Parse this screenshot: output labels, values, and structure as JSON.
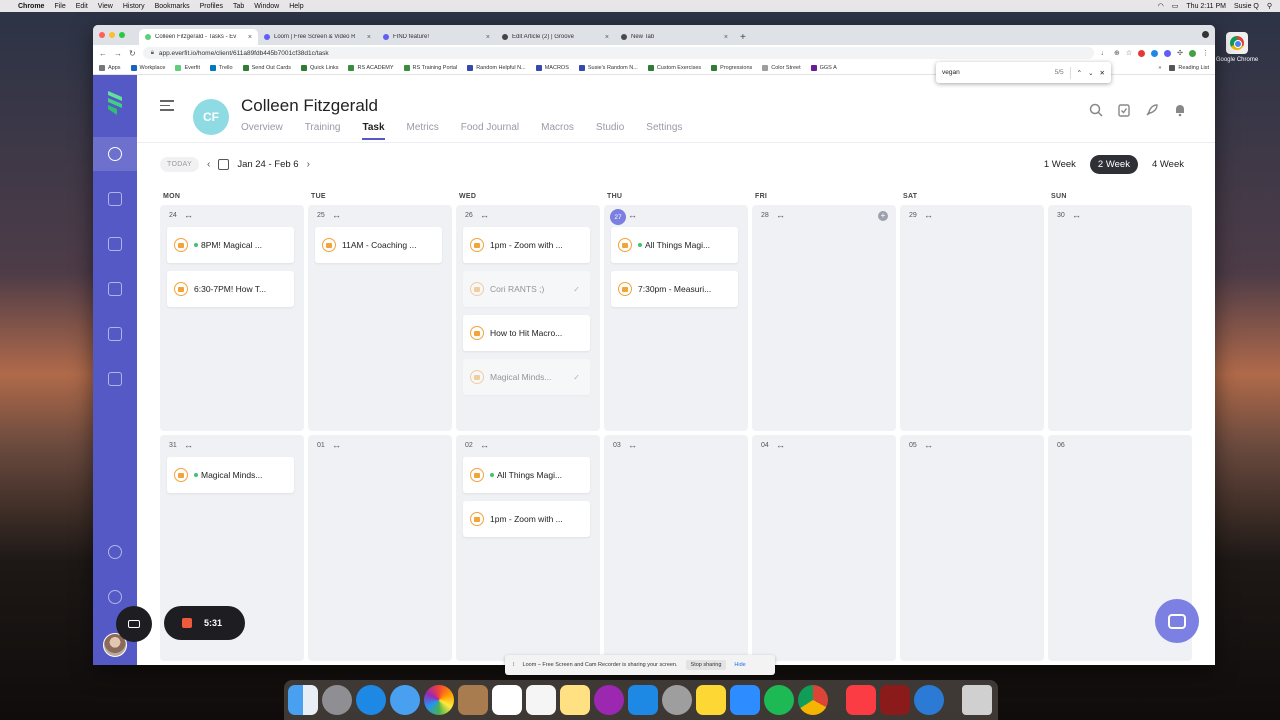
{
  "menubar": {
    "app": "Chrome",
    "items": [
      "File",
      "Edit",
      "View",
      "History",
      "Bookmarks",
      "Profiles",
      "Tab",
      "Window",
      "Help"
    ],
    "clock": "Thu 2:11 PM",
    "user": "Susie Q"
  },
  "desktop": {
    "chrome_label": "Google Chrome"
  },
  "browser": {
    "tabs": [
      {
        "title": "Colleen Fitzgerald - Tasks - Ev",
        "color": "#5ecf7a"
      },
      {
        "title": "Loom | Free Screen & Video R",
        "color": "#625df5"
      },
      {
        "title": "FIND feature!",
        "color": "#625df5"
      },
      {
        "title": "Edit Article (2) | Groove",
        "color": "#444444"
      },
      {
        "title": "New Tab",
        "color": "#4a4a4a"
      }
    ],
    "url": "app.everfit.io/home/client/611a89fdb445b7001cf38d1c/task",
    "bookmarks": [
      "Apps",
      "Workplace",
      "Everfit",
      "Trello",
      "Send Out Cards",
      "Quick Links",
      "RS ACADEMY",
      "RS Training Portal",
      "Random Helpful N...",
      "MACROS",
      "Susie's Random N...",
      "Custom Exercises",
      "Progressions",
      "Color Street",
      "GGS A"
    ],
    "reading_list": "Reading List",
    "find": {
      "query": "vegan",
      "count": "5/5"
    }
  },
  "client": {
    "initials": "CF",
    "name": "Colleen Fitzgerald",
    "tabs": [
      "Overview",
      "Training",
      "Task",
      "Metrics",
      "Food Journal",
      "Macros",
      "Studio",
      "Settings"
    ],
    "active_tab": "Task"
  },
  "toolbar": {
    "today": "TODAY",
    "range": "Jan 24 - Feb 6",
    "views": [
      "1 Week",
      "2 Week",
      "4 Week"
    ],
    "active_view": "2 Week"
  },
  "calendar": {
    "day_names": [
      "MON",
      "TUE",
      "WED",
      "THU",
      "FRI",
      "SAT",
      "SUN"
    ],
    "weeks": [
      [
        {
          "date": "24",
          "tasks": [
            {
              "title": "8PM! Magical ...",
              "dot": true
            },
            {
              "title": "6:30-7PM! How T..."
            }
          ]
        },
        {
          "date": "25",
          "tasks": [
            {
              "title": "11AM - Coaching ..."
            }
          ]
        },
        {
          "date": "26",
          "tasks": [
            {
              "title": "1pm - Zoom with ..."
            },
            {
              "title": "Cori RANTS ;)",
              "done": true
            },
            {
              "title": "How to Hit Macro..."
            },
            {
              "title": "Magical Minds...",
              "done": true
            }
          ]
        },
        {
          "date": "27",
          "today": true,
          "tasks": [
            {
              "title": "All Things Magi...",
              "dot": true
            },
            {
              "title": "7:30pm - Measuri..."
            }
          ]
        },
        {
          "date": "28",
          "plus": true,
          "tasks": []
        },
        {
          "date": "29",
          "tasks": []
        },
        {
          "date": "30",
          "tasks": []
        }
      ],
      [
        {
          "date": "31",
          "tasks": [
            {
              "title": "Magical Minds...",
              "dot": true
            }
          ]
        },
        {
          "date": "01",
          "tasks": []
        },
        {
          "date": "02",
          "tasks": [
            {
              "title": "All Things Magi...",
              "dot": true
            },
            {
              "title": "1pm - Zoom with ..."
            }
          ]
        },
        {
          "date": "03",
          "tasks": []
        },
        {
          "date": "04",
          "tasks": []
        },
        {
          "date": "05",
          "tasks": []
        },
        {
          "date": "06",
          "nodrag": true,
          "tasks": []
        }
      ]
    ]
  },
  "loom": {
    "timer": "5:31",
    "banner": "Loom – Free Screen and Cam Recorder is sharing your screen.",
    "stop": "Stop sharing",
    "hide": "Hide"
  },
  "colors": {
    "brand": "#5559c5",
    "accent": "#7a7fe0",
    "task_icon": "#f2a33a",
    "dot": "#3cc46f"
  }
}
